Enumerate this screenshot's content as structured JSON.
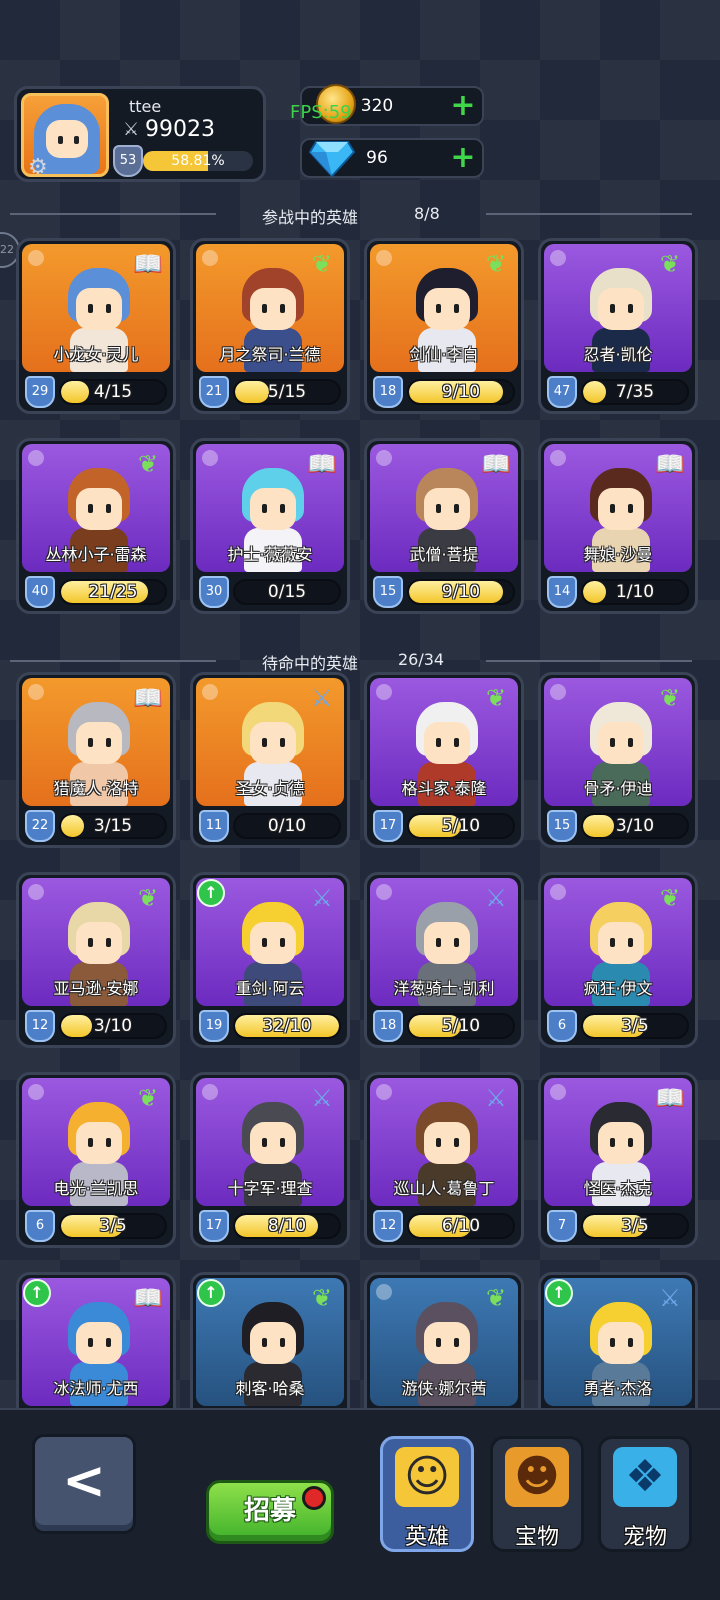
{
  "player": {
    "name": "ttee",
    "power": "99023",
    "level": "53",
    "exp_percent_text": "58.81%",
    "exp_fraction": 0.5881
  },
  "fps": "FPS:59",
  "resources": {
    "coins": "320",
    "gems": "96"
  },
  "side_badge": "22",
  "battle_section": {
    "title": "参战中的英雄",
    "count": "8/8"
  },
  "reserve_section": {
    "title": "待命中的英雄",
    "count": "26/34"
  },
  "battle_heroes": [
    {
      "name": "小龙女·灵儿",
      "level": "29",
      "fragments": "4/15",
      "fill": 0.27,
      "bg": "orange",
      "type": "book",
      "hair": "#5b8fd8",
      "body": "#f2e6d8",
      "upgrade": false
    },
    {
      "name": "月之祭司·兰德",
      "level": "21",
      "fragments": "5/15",
      "fill": 0.33,
      "bg": "orange",
      "type": "wing",
      "hair": "#a1422a",
      "body": "#3b4f8c",
      "upgrade": false
    },
    {
      "name": "剑仙·李白",
      "level": "18",
      "fragments": "9/10",
      "fill": 0.9,
      "bg": "orange",
      "type": "wing",
      "hair": "#1e1e2e",
      "body": "#e8e8f0",
      "upgrade": false
    },
    {
      "name": "忍者·凯伦",
      "level": "47",
      "fragments": "7/35",
      "fill": 0.2,
      "bg": "purple",
      "type": "wing",
      "hair": "#e8e0c8",
      "body": "#1c2a4a",
      "upgrade": false
    },
    {
      "name": "丛林小子·雷森",
      "level": "40",
      "fragments": "21/25",
      "fill": 0.84,
      "bg": "purple",
      "type": "wing",
      "hair": "#c2632a",
      "body": "#7a3d1e",
      "upgrade": false
    },
    {
      "name": "护士·薇薇安",
      "level": "30",
      "fragments": "0/15",
      "fill": 0.0,
      "bg": "purple",
      "type": "book",
      "hair": "#5ed0ea",
      "body": "#f4f4f8",
      "upgrade": false
    },
    {
      "name": "武僧·菩提",
      "level": "15",
      "fragments": "9/10",
      "fill": 0.9,
      "bg": "purple",
      "type": "book",
      "hair": "#b8865a",
      "body": "#3b3b44",
      "upgrade": false
    },
    {
      "name": "舞娘·沙曼",
      "level": "14",
      "fragments": "1/10",
      "fill": 0.1,
      "bg": "purple",
      "type": "book",
      "hair": "#5a2a1e",
      "body": "#e8d4b0",
      "upgrade": false
    }
  ],
  "reserve_heroes": [
    {
      "name": "猎魔人·洛特",
      "level": "22",
      "fragments": "3/15",
      "fill": 0.2,
      "bg": "orange",
      "type": "book",
      "hair": "#b8b8c0",
      "body": "#f0c8a8",
      "upgrade": false
    },
    {
      "name": "圣女·贞德",
      "level": "11",
      "fragments": "0/10",
      "fill": 0.0,
      "bg": "orange",
      "type": "sword",
      "hair": "#f2d878",
      "body": "#e8e8f0",
      "upgrade": false
    },
    {
      "name": "格斗家·泰隆",
      "level": "17",
      "fragments": "5/10",
      "fill": 0.5,
      "bg": "purple",
      "type": "wing",
      "hair": "#f0f0f0",
      "body": "#b03a2a",
      "upgrade": false
    },
    {
      "name": "骨矛·伊迪",
      "level": "15",
      "fragments": "3/10",
      "fill": 0.3,
      "bg": "purple",
      "type": "wing",
      "hair": "#efe8d8",
      "body": "#4a6a5a",
      "upgrade": false
    },
    {
      "name": "亚马逊·安娜",
      "level": "12",
      "fragments": "3/10",
      "fill": 0.3,
      "bg": "purple",
      "type": "wing",
      "hair": "#e8d8a8",
      "body": "#8a5a3a",
      "upgrade": false
    },
    {
      "name": "重剑·阿云",
      "level": "19",
      "fragments": "32/10",
      "fill": 1.0,
      "bg": "purple",
      "type": "sword",
      "hair": "#f5d030",
      "body": "#3e4a7a",
      "upgrade": true
    },
    {
      "name": "洋葱骑士·凯利",
      "level": "18",
      "fragments": "5/10",
      "fill": 0.5,
      "bg": "purple",
      "type": "sword",
      "hair": "#9aa0aa",
      "body": "#6a707a",
      "upgrade": false
    },
    {
      "name": "疯狂·伊文",
      "level": "6",
      "fragments": "3/5",
      "fill": 0.6,
      "bg": "purple",
      "type": "wing",
      "hair": "#f5d060",
      "body": "#2a8ab0",
      "upgrade": false
    },
    {
      "name": "电光·兰凯思",
      "level": "6",
      "fragments": "3/5",
      "fill": 0.6,
      "bg": "purple",
      "type": "wing",
      "hair": "#f5b030",
      "body": "#b8b8c8",
      "upgrade": false
    },
    {
      "name": "十字军·理查",
      "level": "17",
      "fragments": "8/10",
      "fill": 0.8,
      "bg": "purple",
      "type": "sword",
      "hair": "#4a4a52",
      "body": "#3a3a42",
      "upgrade": false
    },
    {
      "name": "巡山人·葛鲁丁",
      "level": "12",
      "fragments": "6/10",
      "fill": 0.6,
      "bg": "purple",
      "type": "sword",
      "hair": "#7a4a2a",
      "body": "#4a3a2a",
      "upgrade": false
    },
    {
      "name": "怪医·杰克",
      "level": "7",
      "fragments": "3/5",
      "fill": 0.6,
      "bg": "purple",
      "type": "book",
      "hair": "#2a2a32",
      "body": "#e8e8f0",
      "upgrade": false
    },
    {
      "name": "冰法师·尤西",
      "level": "",
      "fragments": "",
      "fill": 0.0,
      "bg": "purple",
      "type": "book",
      "hair": "#3a8ad8",
      "body": "#3a8ad8",
      "upgrade": true
    },
    {
      "name": "刺客·哈桑",
      "level": "",
      "fragments": "",
      "fill": 0.0,
      "bg": "blue",
      "type": "wing",
      "hair": "#1e1e24",
      "body": "#2a2a30",
      "upgrade": true
    },
    {
      "name": "游侠·娜尔茜",
      "level": "",
      "fragments": "",
      "fill": 0.0,
      "bg": "blue",
      "type": "wing",
      "hair": "#5a5060",
      "body": "#5a5060",
      "upgrade": false
    },
    {
      "name": "勇者·杰洛",
      "level": "",
      "fragments": "",
      "fill": 0.0,
      "bg": "blue",
      "type": "sword",
      "hair": "#f5d030",
      "body": "#5a7a9a",
      "upgrade": true
    }
  ],
  "type_glyphs": {
    "book": "📖",
    "wing": "❦",
    "sword": "⚔"
  },
  "bottom": {
    "back_label": "<",
    "recruit_label": "招募",
    "tabs": [
      {
        "label": "英雄",
        "icon": "hero-icon",
        "active": true
      },
      {
        "label": "宝物",
        "icon": "treasure-icon",
        "active": false
      },
      {
        "label": "宠物",
        "icon": "pet-icon",
        "active": false
      }
    ]
  }
}
